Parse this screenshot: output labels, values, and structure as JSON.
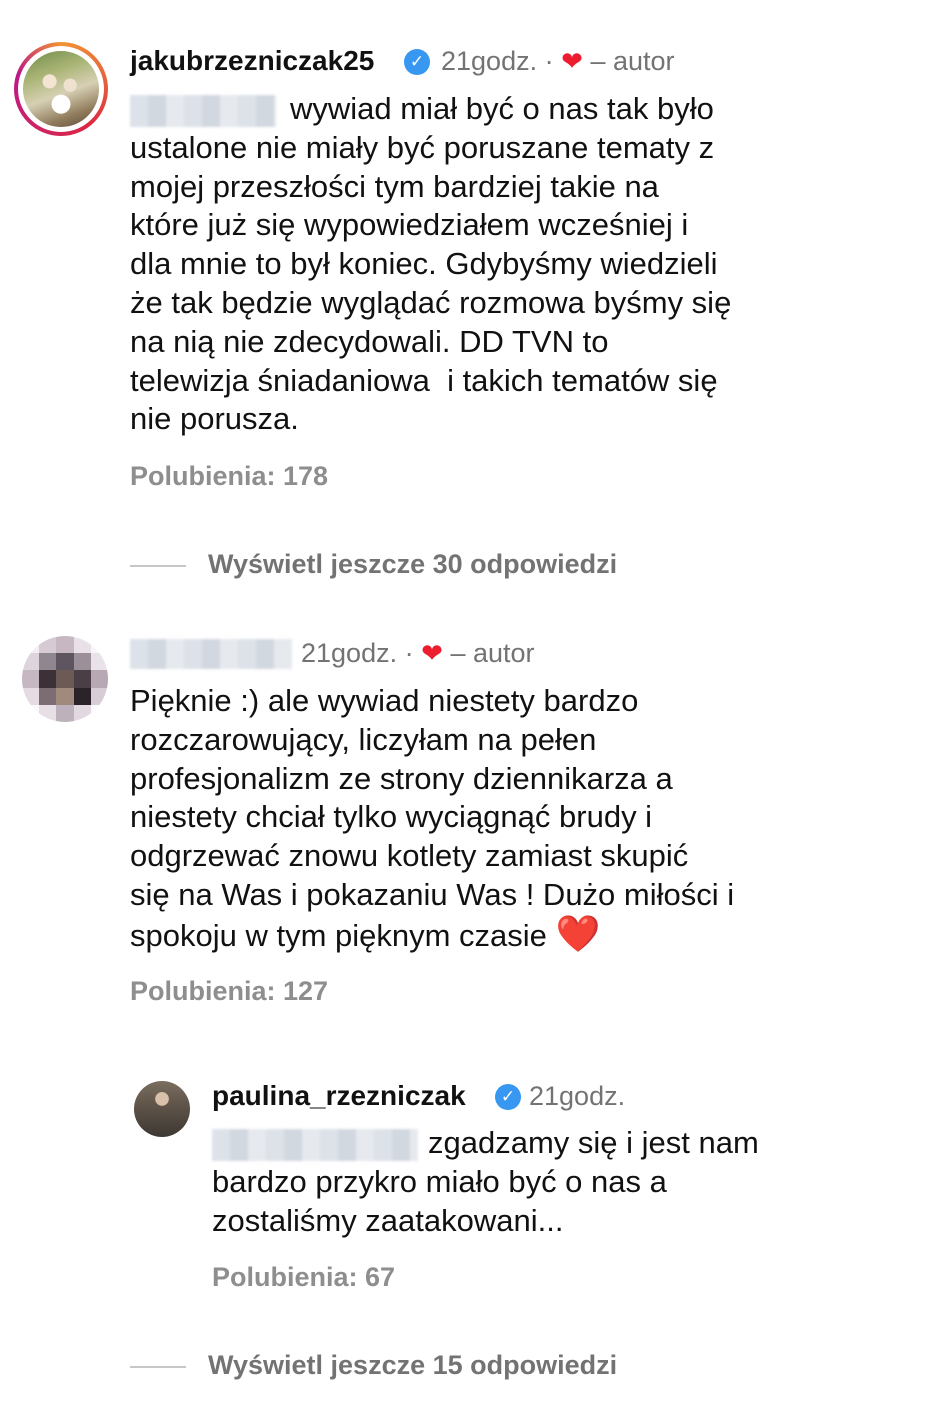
{
  "comments": [
    {
      "username": "jakubrzezniczak25",
      "verified": true,
      "time": "21godz.",
      "separator": "·",
      "liked_by_author_label": "– autor",
      "text_lines": [
        "wywiad miał być o nas tak było",
        "ustalone nie miały być poruszane tematy z",
        "mojej przeszłości tym bardziej takie na",
        "które już się wypowiedziałem wcześniej i",
        "dla mnie to był koniec. Gdybyśmy wiedzieli",
        "że tak będzie wyglądać rozmowa byśmy się",
        "na nią nie zdecydowali. DD TVN to",
        "telewizja śniadaniowa  i takich tematów się",
        "nie porusza."
      ],
      "likes": "Polubienia: 178",
      "view_more": "Wyświetl jeszcze 30 odpowiedzi"
    },
    {
      "time": "21godz.",
      "separator": "·",
      "liked_by_author_label": "– autor",
      "text_lines": [
        "Pięknie :) ale wywiad niestety bardzo",
        "rozczarowujący, liczyłam na pełen",
        "profesjonalizm ze strony dziennikarza a",
        "niestety chciał tylko wyciągnąć brudy i",
        "odgrzewać znowu kotlety zamiast skupić",
        "się na Was i pokazaniu Was ! Dużo miłości i",
        "spokoju w tym pięknym czasie"
      ],
      "end_emoji": "❤️",
      "likes": "Polubienia: 127",
      "reply": {
        "username": "paulina_rzezniczak",
        "verified": true,
        "time": "21godz.",
        "text_lines": [
          "zgadzamy się i jest nam",
          "bardzo przykro miało być o nas a",
          "zostaliśmy zaatakowani..."
        ],
        "likes": "Polubienia: 67"
      },
      "view_more": "Wyświetl jeszcze 15 odpowiedzi"
    }
  ],
  "icons": {
    "verified": "verified-badge-icon",
    "heart": "heart-icon"
  },
  "colors": {
    "text": "#111111",
    "meta": "#737373",
    "likes": "#8e8e8e",
    "verified": "#3897f0",
    "heart": "#ed1c2e"
  }
}
